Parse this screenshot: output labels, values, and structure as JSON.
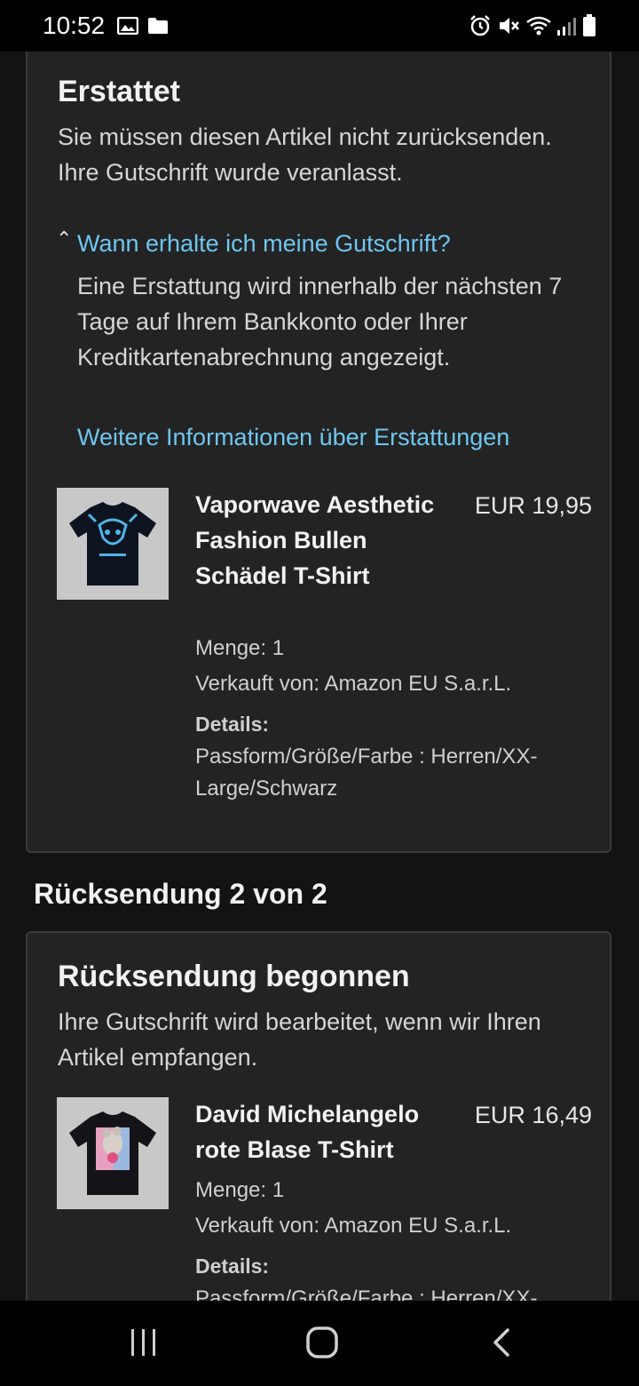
{
  "status_bar": {
    "time": "10:52"
  },
  "refund_card": {
    "title": "Erstattet",
    "message": "Sie müssen diesen Artikel nicht zurücksenden. Ihre Gutschrift wurde veranlasst.",
    "expand_link": "Wann erhalte ich meine Gutschrift?",
    "expanded_text": "Eine Erstattung wird innerhalb der nächsten 7 Tage auf Ihrem Bankkonto oder Ihrer Kreditkartenabrechnung angezeigt.",
    "more_info_link": "Weitere Informationen über Erstattungen",
    "product": {
      "title": "Vaporwave Aesthetic Fashion Bullen Schädel T-Shirt",
      "price": "EUR 19,95",
      "quantity": "Menge: 1",
      "seller": "Verkauft von: Amazon EU S.a.r.L.",
      "details_label": "Details:",
      "details_value": "Passform/Größe/Farbe : Herren/XX-Large/Schwarz"
    }
  },
  "section_heading": "Rücksendung 2 von 2",
  "return_card": {
    "title": "Rücksendung begonnen",
    "message": "Ihre Gutschrift wird bearbeitet, wenn wir Ihren Artikel empfangen.",
    "product": {
      "title": "David Michelangelo rote Blase T-Shirt",
      "price": "EUR 16,49",
      "quantity": "Menge: 1",
      "seller": "Verkauft von: Amazon EU S.a.r.L.",
      "details_label": "Details:",
      "details_value": "Passform/Größe/Farbe : Herren/XX-"
    }
  },
  "colors": {
    "background": "#131313",
    "card": "#232323",
    "link": "#6ec6f0"
  },
  "icons": [
    "image-icon",
    "folder-icon",
    "alarm-icon",
    "mute-icon",
    "wifi-icon",
    "signal-icon",
    "battery-icon",
    "recent-apps-icon",
    "home-icon",
    "back-icon"
  ]
}
